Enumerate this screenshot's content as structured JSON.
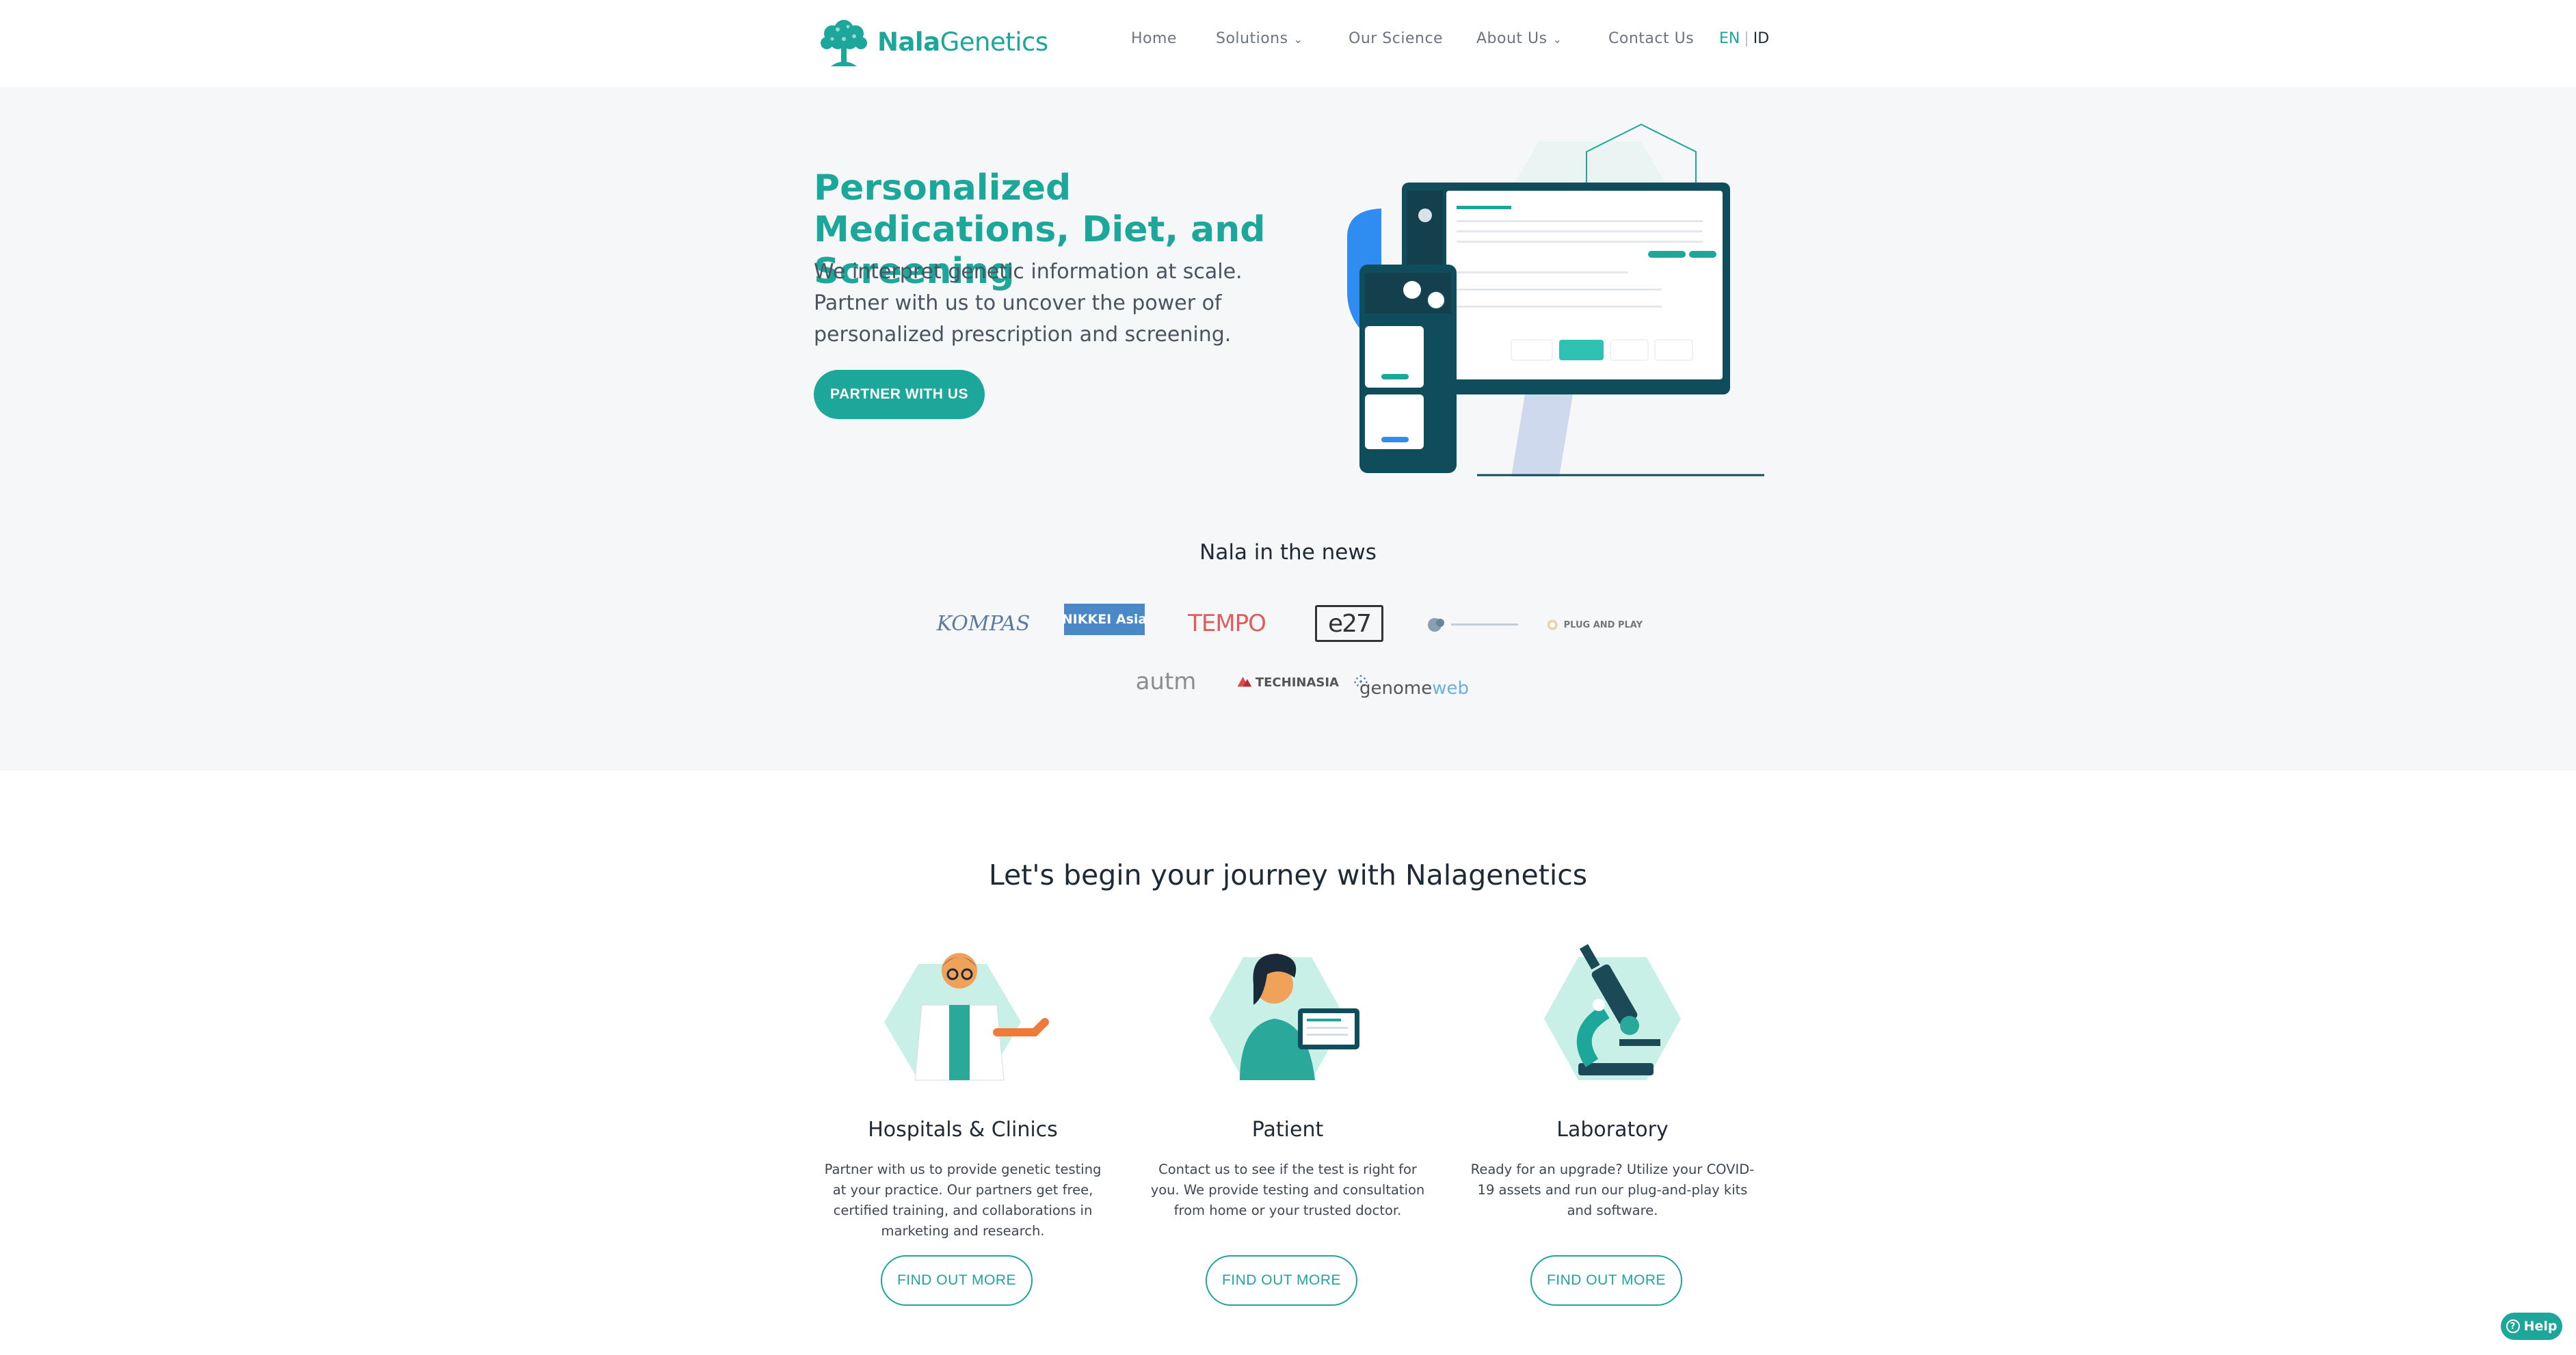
{
  "header": {
    "logo": {
      "brand_bold": "Nala",
      "brand_rest": "Genetics"
    },
    "nav": [
      {
        "label": "Home",
        "has_dropdown": false
      },
      {
        "label": "Solutions",
        "has_dropdown": true
      },
      {
        "label": "Our Science",
        "has_dropdown": false
      },
      {
        "label": "About Us",
        "has_dropdown": true
      },
      {
        "label": "Contact Us",
        "has_dropdown": false
      }
    ],
    "lang": {
      "en": "EN",
      "separator": "|",
      "id": "ID"
    }
  },
  "hero": {
    "title": "Personalized Medications, Diet, and Screening",
    "subtitle": "We interpret genetic information at scale. Partner with us to uncover the power of personalized prescription and screening.",
    "cta_label": "PARTNER WITH US"
  },
  "news": {
    "title": "Nala in the news",
    "logos": [
      {
        "name": "kompas",
        "text": "KOMPAS"
      },
      {
        "name": "nikkei-asia",
        "text": "NIKKEI Asia"
      },
      {
        "name": "tempo",
        "text": "TEMPO"
      },
      {
        "name": "e27",
        "text": "e27"
      },
      {
        "name": "publication",
        "text": ""
      },
      {
        "name": "plug-and-play",
        "text": "PLUG AND PLAY"
      },
      {
        "name": "autm",
        "text": "autm"
      },
      {
        "name": "techinasia",
        "text": "TECHINASIA"
      },
      {
        "name": "genomeweb",
        "text_a": "genome",
        "text_b": "web"
      }
    ]
  },
  "journey": {
    "title": "Let's begin your journey with Nalagenetics",
    "cards": [
      {
        "title": "Hospitals & Clinics",
        "description": "Partner with us to provide genetic testing at your practice. Our partners get free, certified training, and collaborations in marketing and research.",
        "button": "FIND OUT MORE"
      },
      {
        "title": "Patient",
        "description": "Contact us to see if the test is right for you. We provide testing and consultation from home or your trusted doctor.",
        "button": "FIND OUT MORE"
      },
      {
        "title": "Laboratory",
        "description": "Ready for an upgrade? Utilize your COVID-19 assets and run our plug-and-play kits and software.",
        "button": "FIND OUT MORE"
      }
    ]
  },
  "help": {
    "label": "Help"
  },
  "colors": {
    "accent": "#1da79b",
    "hero_bg": "#f5f7f9",
    "dark_text": "#1f2a37"
  }
}
